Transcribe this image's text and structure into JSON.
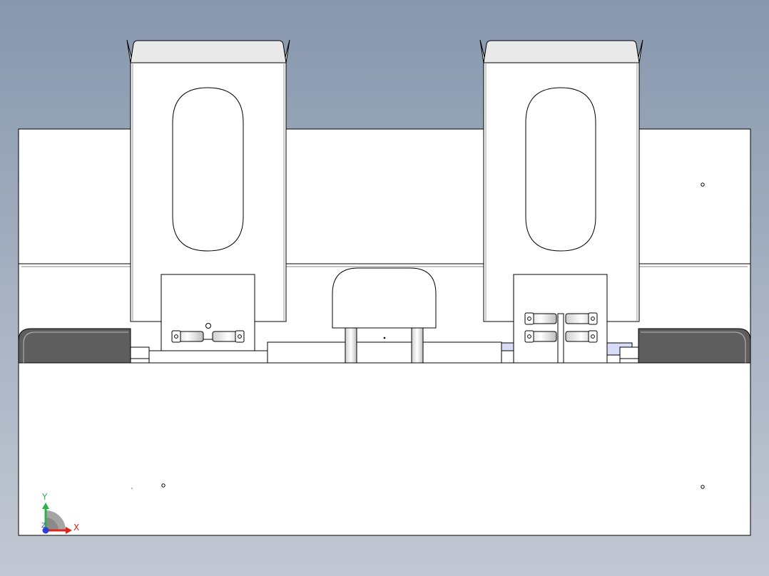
{
  "view": {
    "background_top": "#8797ad",
    "background_bottom": "#c2c8d3",
    "part_fill": "#ffffff",
    "dark_pad_fill": "#5e5e5e",
    "tab_fill": "#e9e9e9",
    "highlight_fill": "#d8dcf6",
    "edge_color": "#000000"
  },
  "triad": {
    "x_label": "X",
    "y_label": "Y",
    "z_label": "Z",
    "x_color": "#e0231b",
    "y_color": "#2bb34a",
    "z_color": "#2a3fd6"
  }
}
